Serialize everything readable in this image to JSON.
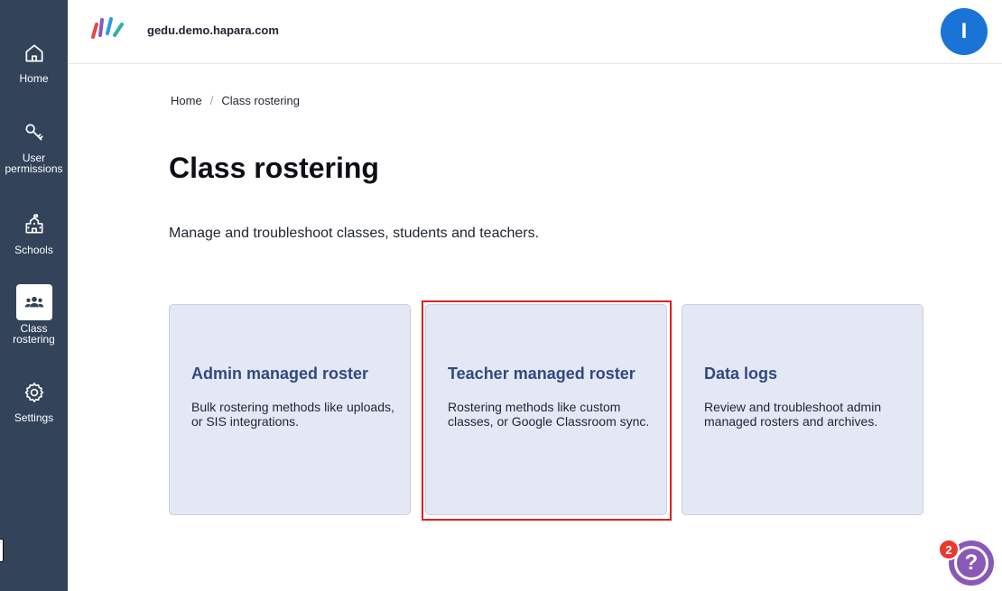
{
  "sidebar": {
    "items": [
      {
        "label": "Home",
        "icon": "home-icon"
      },
      {
        "label": "User\npermissions",
        "icon": "key-icon"
      },
      {
        "label": "Schools",
        "icon": "school-icon"
      },
      {
        "label": "Class\nrostering",
        "icon": "users-icon",
        "active": true
      },
      {
        "label": "Settings",
        "icon": "gear-icon"
      }
    ]
  },
  "header": {
    "domain": "gedu.demo.hapara.com",
    "avatar_initial": "I"
  },
  "breadcrumb": {
    "home": "Home",
    "separator": "/",
    "current": "Class rostering"
  },
  "page": {
    "title": "Class rostering",
    "description": "Manage and troubleshoot classes, students and teachers."
  },
  "cards": [
    {
      "title": "Admin managed roster",
      "description": "Bulk rostering methods like uploads, or SIS integrations."
    },
    {
      "title": "Teacher managed roster",
      "description": "Rostering methods like custom classes, or Google Classroom sync."
    },
    {
      "title": "Data logs",
      "description": "Review and troubleshoot admin managed rosters and archives."
    }
  ],
  "help": {
    "icon": "question-icon",
    "badge_count": "2"
  },
  "colors": {
    "sidebar": "#33435a",
    "card_bg": "#e4e8f4",
    "card_title": "#2e4a82",
    "avatar": "#1a73d6",
    "help": "#8a58b6",
    "badge": "#e8392f",
    "highlight": "#e0201e"
  }
}
